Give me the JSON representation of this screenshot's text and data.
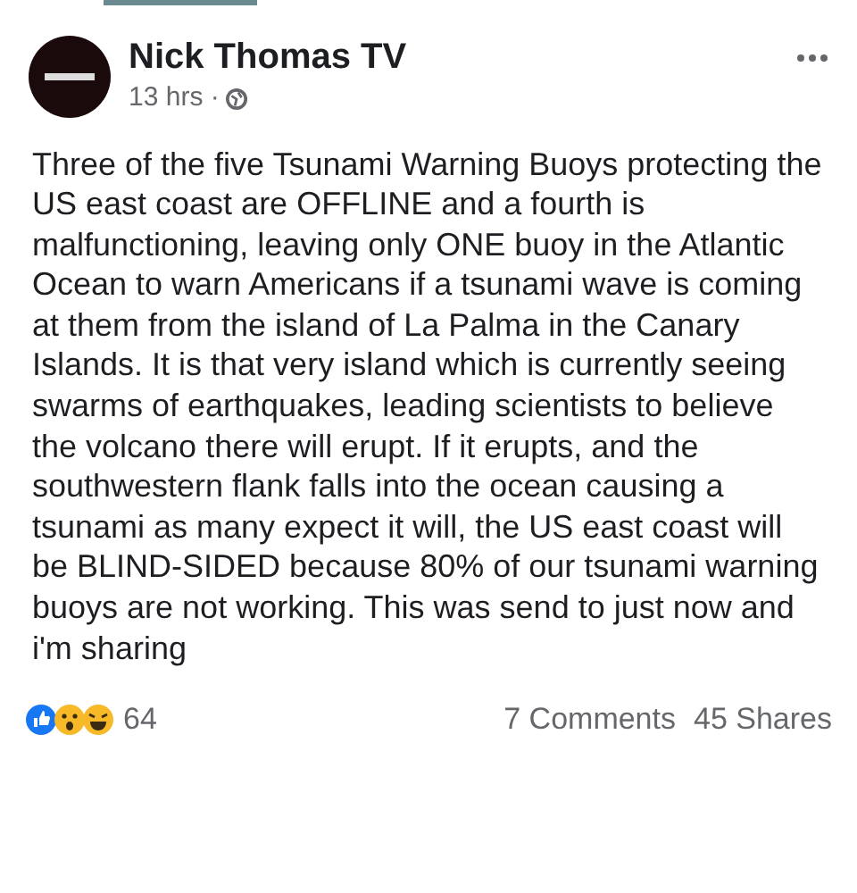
{
  "post": {
    "author": "Nick Thomas TV",
    "time": "13 hrs ·",
    "text": "Three of the five Tsunami Warning Buoys protecting the US east coast are OFFLINE and a fourth is malfunctioning, leaving only ONE buoy in the Atlantic Ocean to warn Americans if a tsunami wave is coming at them from the island of La Palma in the Canary Islands.  It is that very island which is currently seeing swarms of earthquakes, leading scientists to believe the volcano there will erupt. If it erupts, and the southwestern flank falls into the ocean causing a tsunami as many expect it will, the US east coast will be BLIND-SIDED because 80% of our tsunami warning buoys are not working. This was send to just now and i'm sharing"
  },
  "footer": {
    "reactions_count": "64",
    "comments": "7 Comments",
    "shares": "45 Shares"
  }
}
